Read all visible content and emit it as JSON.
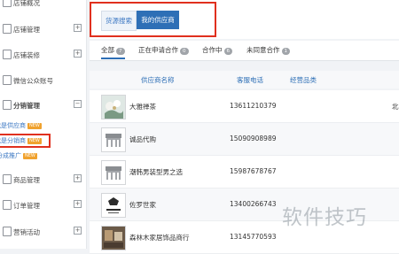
{
  "sidebar": {
    "items": [
      {
        "label": "店铺概况",
        "sign": ""
      },
      {
        "label": "店铺管理",
        "sign": "+"
      },
      {
        "label": "店铺装修",
        "sign": "+"
      },
      {
        "label": "微信公众账号",
        "sign": ""
      },
      {
        "label": "分销管理",
        "sign": "−"
      },
      {
        "label": "商品管理",
        "sign": "+"
      },
      {
        "label": "订单管理",
        "sign": "+"
      },
      {
        "label": "营销活动",
        "sign": "+"
      }
    ],
    "sub_items": [
      {
        "label": "我是供应商",
        "badge": "NEW"
      },
      {
        "label": "我是分销商",
        "badge": "NEW"
      },
      {
        "label": "分成推广",
        "badge": "NEW"
      }
    ]
  },
  "toolbar": {
    "search_label": "货源搜索",
    "my_suppliers_label": "我的供应商"
  },
  "tabs": [
    {
      "label": "全部",
      "count": "7"
    },
    {
      "label": "正在申请合作",
      "count": "0"
    },
    {
      "label": "合作中",
      "count": "6"
    },
    {
      "label": "未同意合作",
      "count": "1"
    }
  ],
  "table": {
    "headers": [
      "供应商名称",
      "客服电话",
      "经营品类"
    ],
    "rows": [
      {
        "name": "大雅禅茶",
        "phone": "13611210379",
        "region": "北",
        "thumb": "tea-photo"
      },
      {
        "name": "诚品代购",
        "phone": "15090908989",
        "region": "",
        "thumb": "shop-icon"
      },
      {
        "name": "潮韩男装型男之选",
        "phone": "15987678767",
        "region": "",
        "thumb": "shop-icon"
      },
      {
        "name": "佐罗世家",
        "phone": "13400266743",
        "region": "",
        "thumb": "zorro-logo"
      },
      {
        "name": "森林木家居饰品商行",
        "phone": "13145770593",
        "region": "",
        "thumb": "furniture-photo"
      }
    ]
  },
  "watermark": "软件技巧",
  "colors": {
    "accent": "#2e6fb6",
    "highlight": "#e0301e",
    "badge": "#f0a22e"
  }
}
